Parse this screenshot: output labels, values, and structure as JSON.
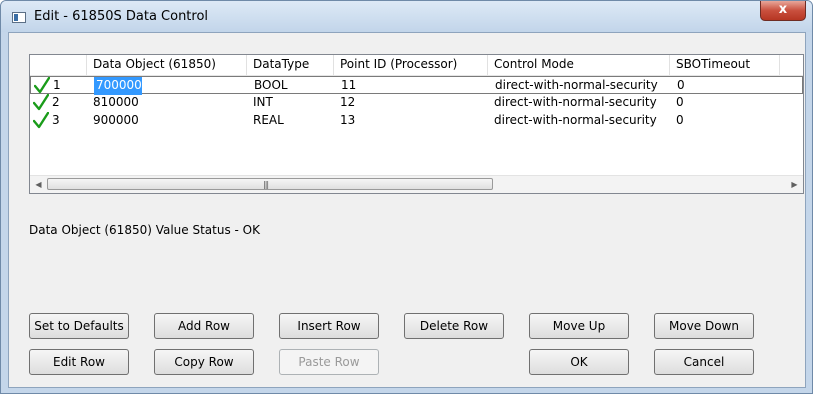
{
  "window": {
    "title": "Edit - 61850S Data Control",
    "close_glyph": "x"
  },
  "grid": {
    "columns": [
      "Data Object (61850)",
      "DataType",
      "Point ID (Processor)",
      "Control Mode",
      "SBOTimeout"
    ],
    "rows": [
      {
        "num": "1",
        "data_object": "700000",
        "data_type": "BOOL",
        "point_id": "11",
        "control_mode": "direct-with-normal-security",
        "sbo_timeout": "0"
      },
      {
        "num": "2",
        "data_object": "810000",
        "data_type": "INT",
        "point_id": "12",
        "control_mode": "direct-with-normal-security",
        "sbo_timeout": "0"
      },
      {
        "num": "3",
        "data_object": "900000",
        "data_type": "REAL",
        "point_id": "13",
        "control_mode": "direct-with-normal-security",
        "sbo_timeout": "0"
      }
    ],
    "check_color": "#1a9c1a",
    "selection_color": "#3399ff"
  },
  "status_text": "Data Object (61850) Value Status - OK",
  "buttons": {
    "set_to_defaults": "Set to Defaults",
    "add_row": "Add Row",
    "insert_row": "Insert Row",
    "delete_row": "Delete Row",
    "move_up": "Move Up",
    "move_down": "Move Down",
    "edit_row": "Edit Row",
    "copy_row": "Copy Row",
    "paste_row": "Paste Row",
    "ok": "OK",
    "cancel": "Cancel"
  }
}
